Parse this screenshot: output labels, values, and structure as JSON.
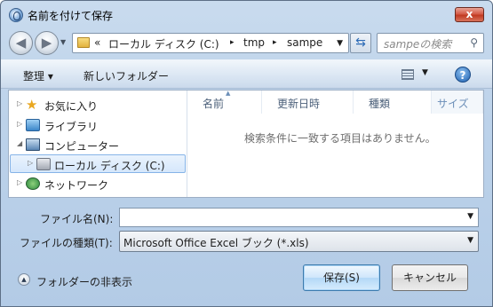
{
  "window": {
    "title": "名前を付けて保存",
    "close_label": "x"
  },
  "address": {
    "overflow": "«",
    "segments": [
      "ローカル ディスク (C:)",
      "tmp",
      "sampe"
    ],
    "separator": "▸",
    "search_placeholder": "sampeの検索"
  },
  "toolbar": {
    "organize_label": "整理 ▾",
    "new_folder_label": "新しいフォルダー"
  },
  "nav": {
    "items": [
      {
        "label": "お気に入り",
        "expander": "▷"
      },
      {
        "label": "ライブラリ",
        "expander": "▷"
      },
      {
        "label": "コンピューター",
        "expander": "◢"
      },
      {
        "label": "ローカル ディスク (C:)",
        "expander": "▷"
      },
      {
        "label": "ネットワーク",
        "expander": "▷"
      }
    ]
  },
  "columns": [
    "名前",
    "更新日時",
    "種類",
    "サイズ"
  ],
  "empty_message": "検索条件に一致する項目はありません。",
  "form": {
    "filename_label": "ファイル名(N):",
    "filename_value": "",
    "filetype_label": "ファイルの種類(T):",
    "filetype_value": "Microsoft Office Excel ブック (*.xls)"
  },
  "footer": {
    "hide_folders_label": "フォルダーの非表示",
    "save_label": "保存(S)",
    "cancel_label": "キャンセル"
  },
  "colors": {
    "accent": "#2d6bb6",
    "selection": "#d5e7fb"
  }
}
